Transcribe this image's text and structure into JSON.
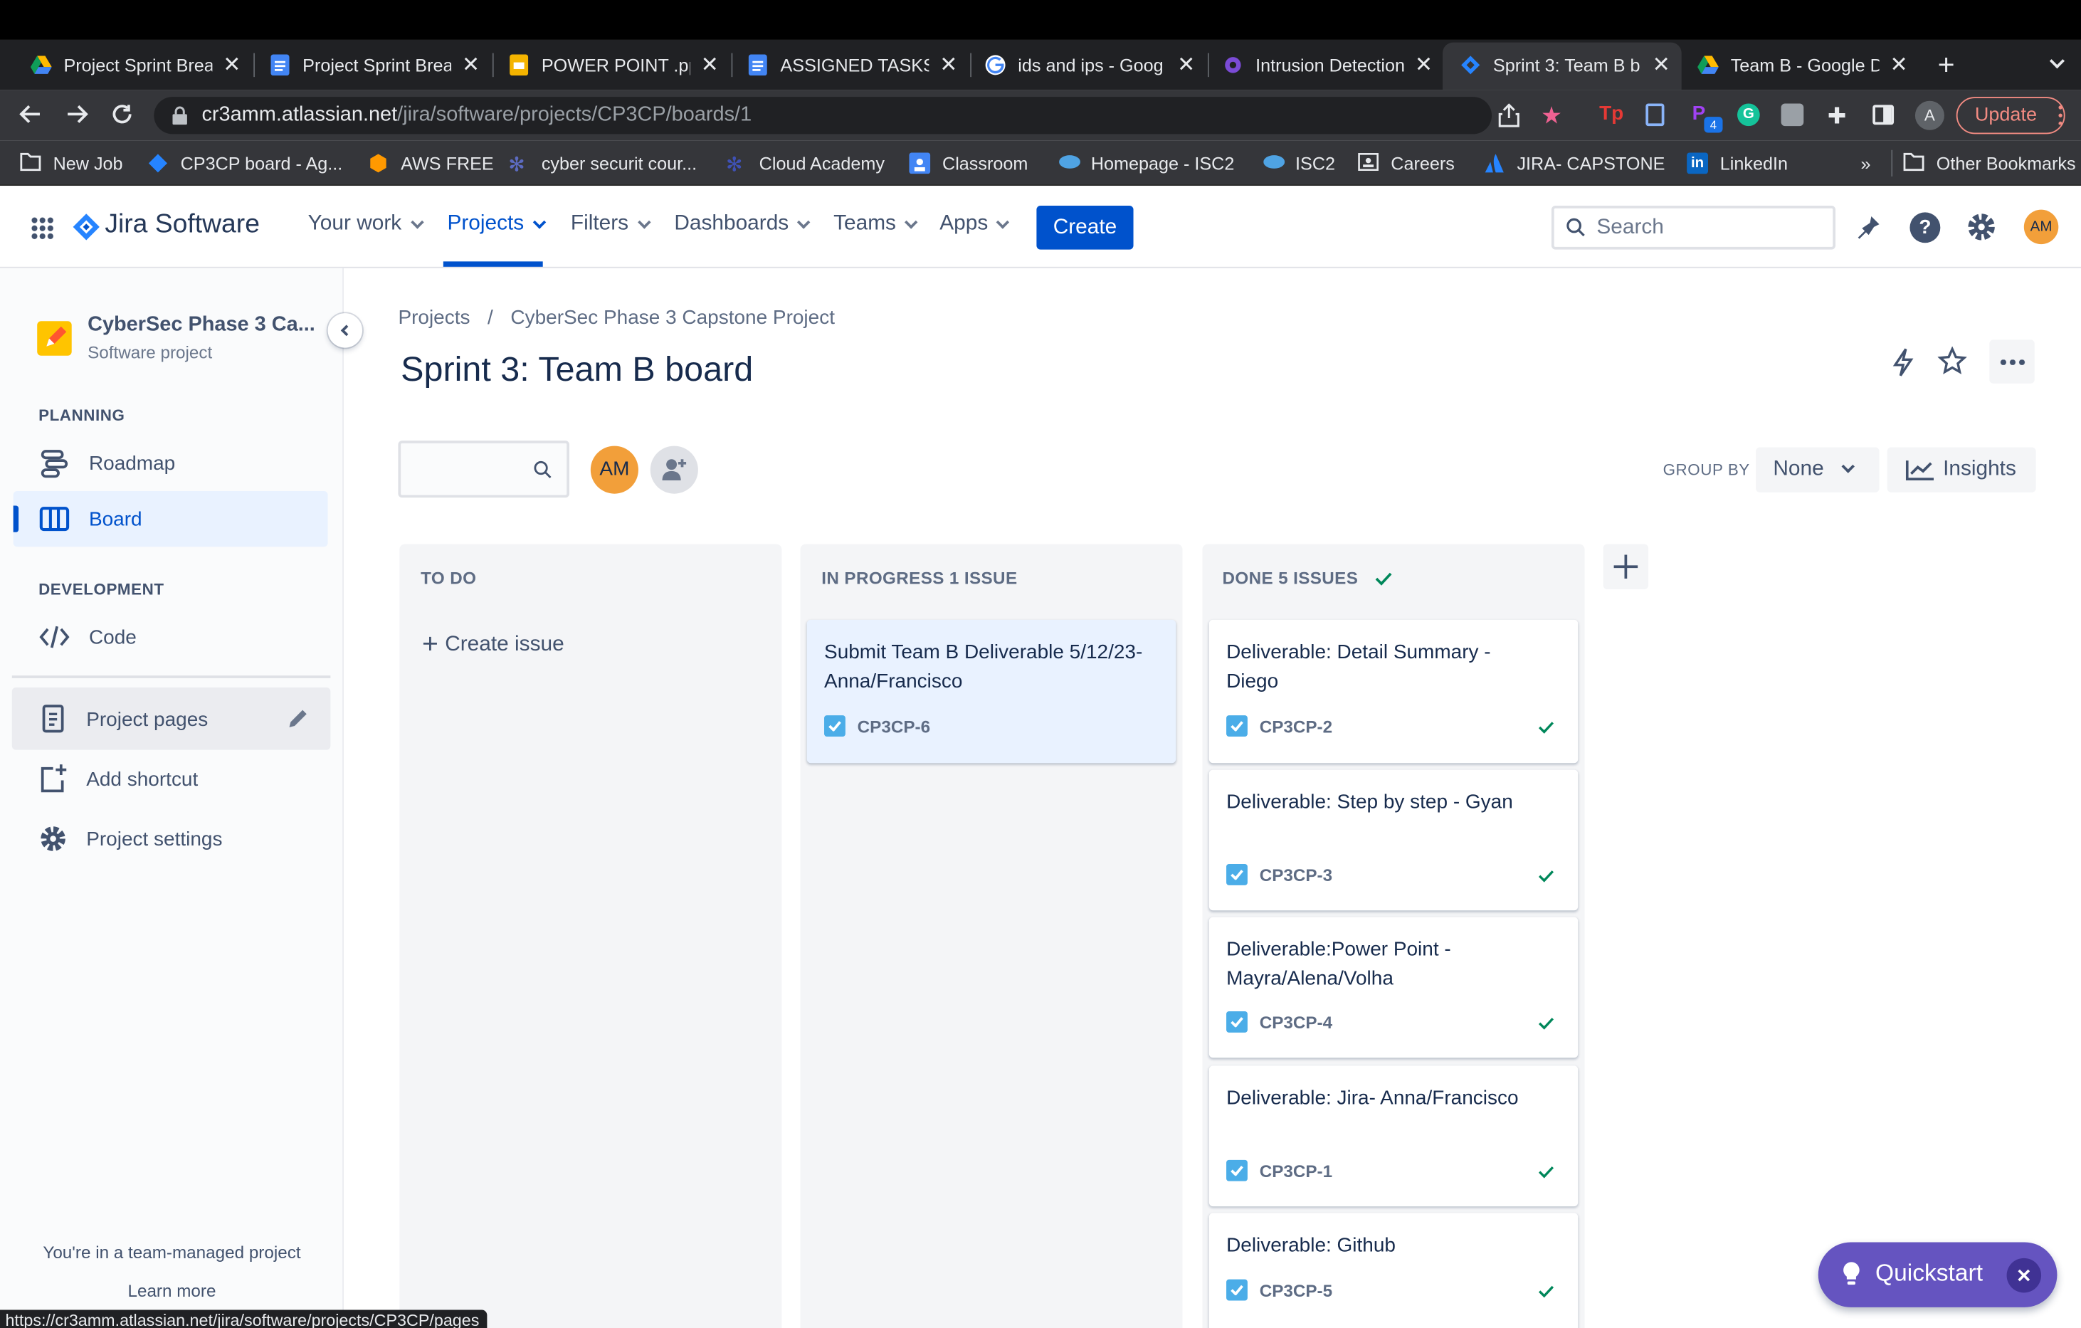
{
  "browser": {
    "tabs": [
      {
        "title": "Project Sprint Brea",
        "icon": "google-drive-icon"
      },
      {
        "title": "Project Sprint Brea",
        "icon": "google-docs-icon"
      },
      {
        "title": "POWER POINT .pp",
        "icon": "google-slides-icon"
      },
      {
        "title": "ASSIGNED TASKS",
        "icon": "google-docs-icon"
      },
      {
        "title": "ids and ips - Goog",
        "icon": "google-icon"
      },
      {
        "title": "Intrusion Detection",
        "icon": "app-icon"
      },
      {
        "title": "Sprint 3: Team B b",
        "icon": "jira-icon"
      },
      {
        "title": "Team B - Google D",
        "icon": "google-drive-icon"
      }
    ],
    "url_domain": "cr3amm.atlassian.net",
    "url_path": "/jira/software/projects/CP3CP/boards/1",
    "update_label": "Update",
    "profile_initial": "A",
    "extension_badge": "4",
    "bookmarks": [
      "New Job",
      "CP3CP board - Ag...",
      "AWS FREE",
      "cyber securit cour...",
      "Cloud Academy",
      "Classroom",
      "Homepage - ISC2",
      "ISC2",
      "Careers",
      "JIRA- CAPSTONE",
      "LinkedIn"
    ],
    "bookmarks_more": "»",
    "other_bookmarks": "Other Bookmarks"
  },
  "jira": {
    "product": "Jira Software",
    "nav": [
      "Your work",
      "Projects",
      "Filters",
      "Dashboards",
      "Teams",
      "Apps"
    ],
    "create_label": "Create",
    "search_placeholder": "Search",
    "avatar": "AM"
  },
  "sidebar": {
    "project_name": "CyberSec Phase 3 Ca...",
    "project_type": "Software project",
    "planning_label": "PLANNING",
    "roadmap": "Roadmap",
    "board": "Board",
    "development_label": "DEVELOPMENT",
    "code": "Code",
    "project_pages": "Project pages",
    "add_shortcut": "Add shortcut",
    "project_settings": "Project settings",
    "team_managed": "You're in a team-managed project",
    "learn_more": "Learn more"
  },
  "main": {
    "breadcrumb": [
      "Projects",
      "/",
      "CyberSec Phase 3 Capstone Project"
    ],
    "title": "Sprint 3: Team B board",
    "avatar": "AM",
    "group_by_label": "GROUP BY",
    "group_by_value": "None",
    "insights_label": "Insights",
    "columns": {
      "todo": {
        "title": "TO DO",
        "create_issue": "Create issue"
      },
      "inprogress": {
        "title": "IN PROGRESS 1 ISSUE"
      },
      "done": {
        "title": "DONE 5 ISSUES"
      }
    },
    "inprogress_cards": [
      {
        "title": "Submit Team B Deliverable 5/12/23- Anna/Francisco",
        "key": "CP3CP-6"
      }
    ],
    "done_cards": [
      {
        "title": "Deliverable: Detail Summary - Diego",
        "key": "CP3CP-2"
      },
      {
        "title": "Deliverable: Step by step - Gyan",
        "key": "CP3CP-3"
      },
      {
        "title": "Deliverable:Power Point - Mayra/Alena/Volha",
        "key": "CP3CP-4"
      },
      {
        "title": "Deliverable: Jira- Anna/Francisco",
        "key": "CP3CP-1"
      },
      {
        "title": "Deliverable: Github",
        "key": "CP3CP-5"
      }
    ]
  },
  "quickstart_label": "Quickstart",
  "status_url": "https://cr3amm.atlassian.net/jira/software/projects/CP3CP/pages",
  "colors": {
    "jira_blue": "#0052CC",
    "avatar_orange": "#F29F3A",
    "quickstart_purple": "#6554C0",
    "checkbox_blue": "#4BADE8",
    "done_green": "#00875A"
  }
}
